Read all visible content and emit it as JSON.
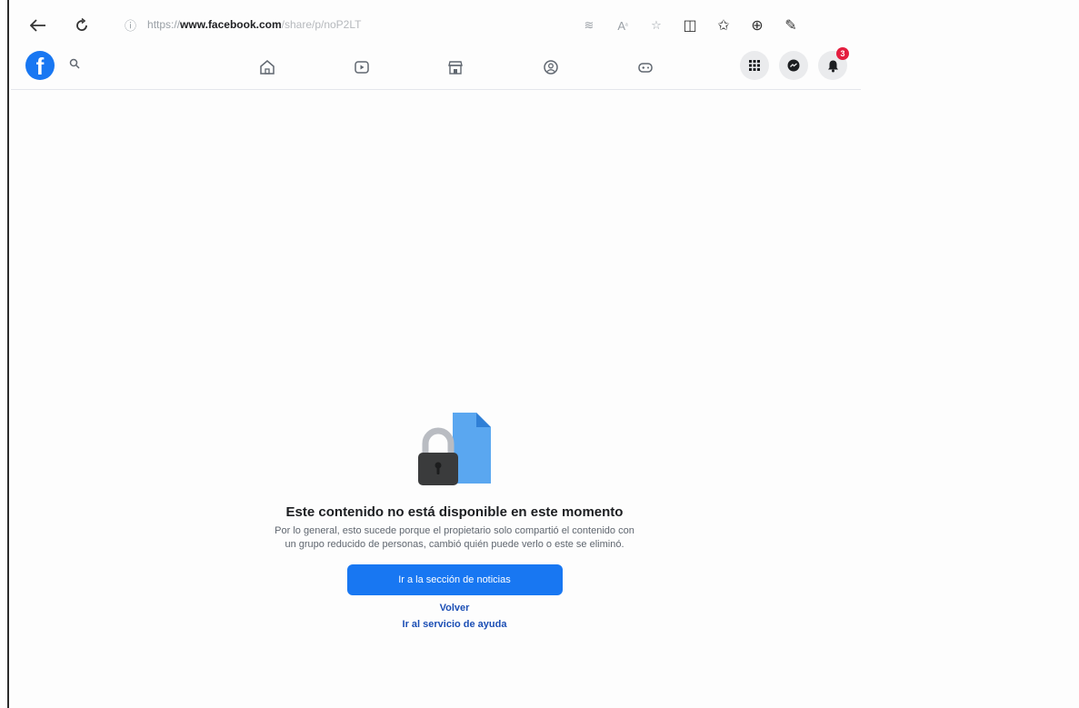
{
  "browser": {
    "url_prefix": "https://",
    "url_domain": "www.facebook.com",
    "url_path": "/share/p/noP2LT"
  },
  "header": {
    "logo_letter": "f",
    "notification_count": "3"
  },
  "main": {
    "title": "Este contenido no está disponible en este momento",
    "description": "Por lo general, esto sucede porque el propietario solo compartió el contenido con un grupo reducido de personas, cambió quién puede verlo o este se eliminó.",
    "primary_button": "Ir a la sección de noticias",
    "back_link": "Volver",
    "help_link": "Ir al servicio de ayuda"
  },
  "colors": {
    "accent": "#1877f2",
    "link": "#1c4fb5",
    "badge": "#e41e3f"
  },
  "icons": {
    "browser": [
      "back-arrow-icon",
      "reload-icon",
      "info-icon",
      "read-aloud-icon",
      "text-size-icon",
      "favorite-icon",
      "split-screen-icon",
      "favorites-bar-icon",
      "collections-icon",
      "extensions-icon"
    ],
    "nav": [
      "home-icon",
      "video-icon",
      "marketplace-icon",
      "groups-icon",
      "gaming-icon"
    ],
    "right": [
      "menu-grid-icon",
      "messenger-icon",
      "notifications-icon"
    ]
  }
}
